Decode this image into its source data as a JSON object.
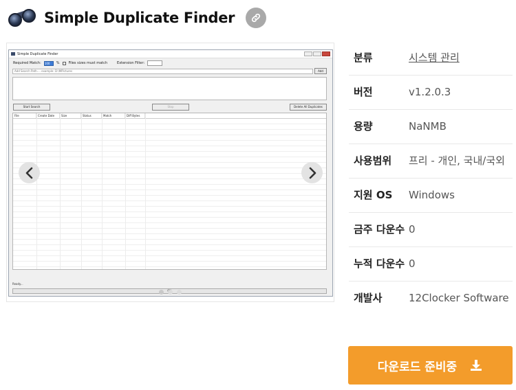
{
  "app": {
    "title": "Simple Duplicate Finder"
  },
  "screenshot": {
    "window_title": "Simple Duplicate Finder",
    "required_match_label": "Required Match:",
    "required_match_value": "100",
    "percent_sign": "%",
    "sizes_must_match_label": "Files sizes must match",
    "extension_filter_label": "Extension Filter:",
    "path_placeholder": "Add Search Path.... example: D:\\MPictures",
    "add_label": "Add",
    "start_label": "Start Search",
    "stop_label": "Stop",
    "delete_all_label": "Delete All Duplicates",
    "columns": [
      "File",
      "Create Date",
      "Size",
      "Status",
      "Match",
      "Diff Bytes"
    ],
    "status_text": "Ready...",
    "progress_text": "0%"
  },
  "carousel": {
    "slide_count": 3,
    "active_index": 0
  },
  "info": [
    {
      "label": "분류",
      "value": "시스템 관리",
      "link": true
    },
    {
      "label": "버전",
      "value": "v1.2.0.3"
    },
    {
      "label": "용량",
      "value": "NaNMB"
    },
    {
      "label": "사용범위",
      "value": "프리 - 개인, 국내/국외"
    },
    {
      "label": "지원 OS",
      "value": "Windows"
    },
    {
      "label": "금주 다운수",
      "value": "0"
    },
    {
      "label": "누적 다운수",
      "value": "0"
    },
    {
      "label": "개발사",
      "value": "12Clocker Software"
    }
  ],
  "download": {
    "label": "다운로드 준비중"
  },
  "colors": {
    "accent": "#f39c2b",
    "link_button": "#a9a9a9"
  },
  "icons": {
    "link": "link-icon",
    "prev": "chevron-left-icon",
    "next": "chevron-right-icon",
    "download": "download-icon"
  }
}
